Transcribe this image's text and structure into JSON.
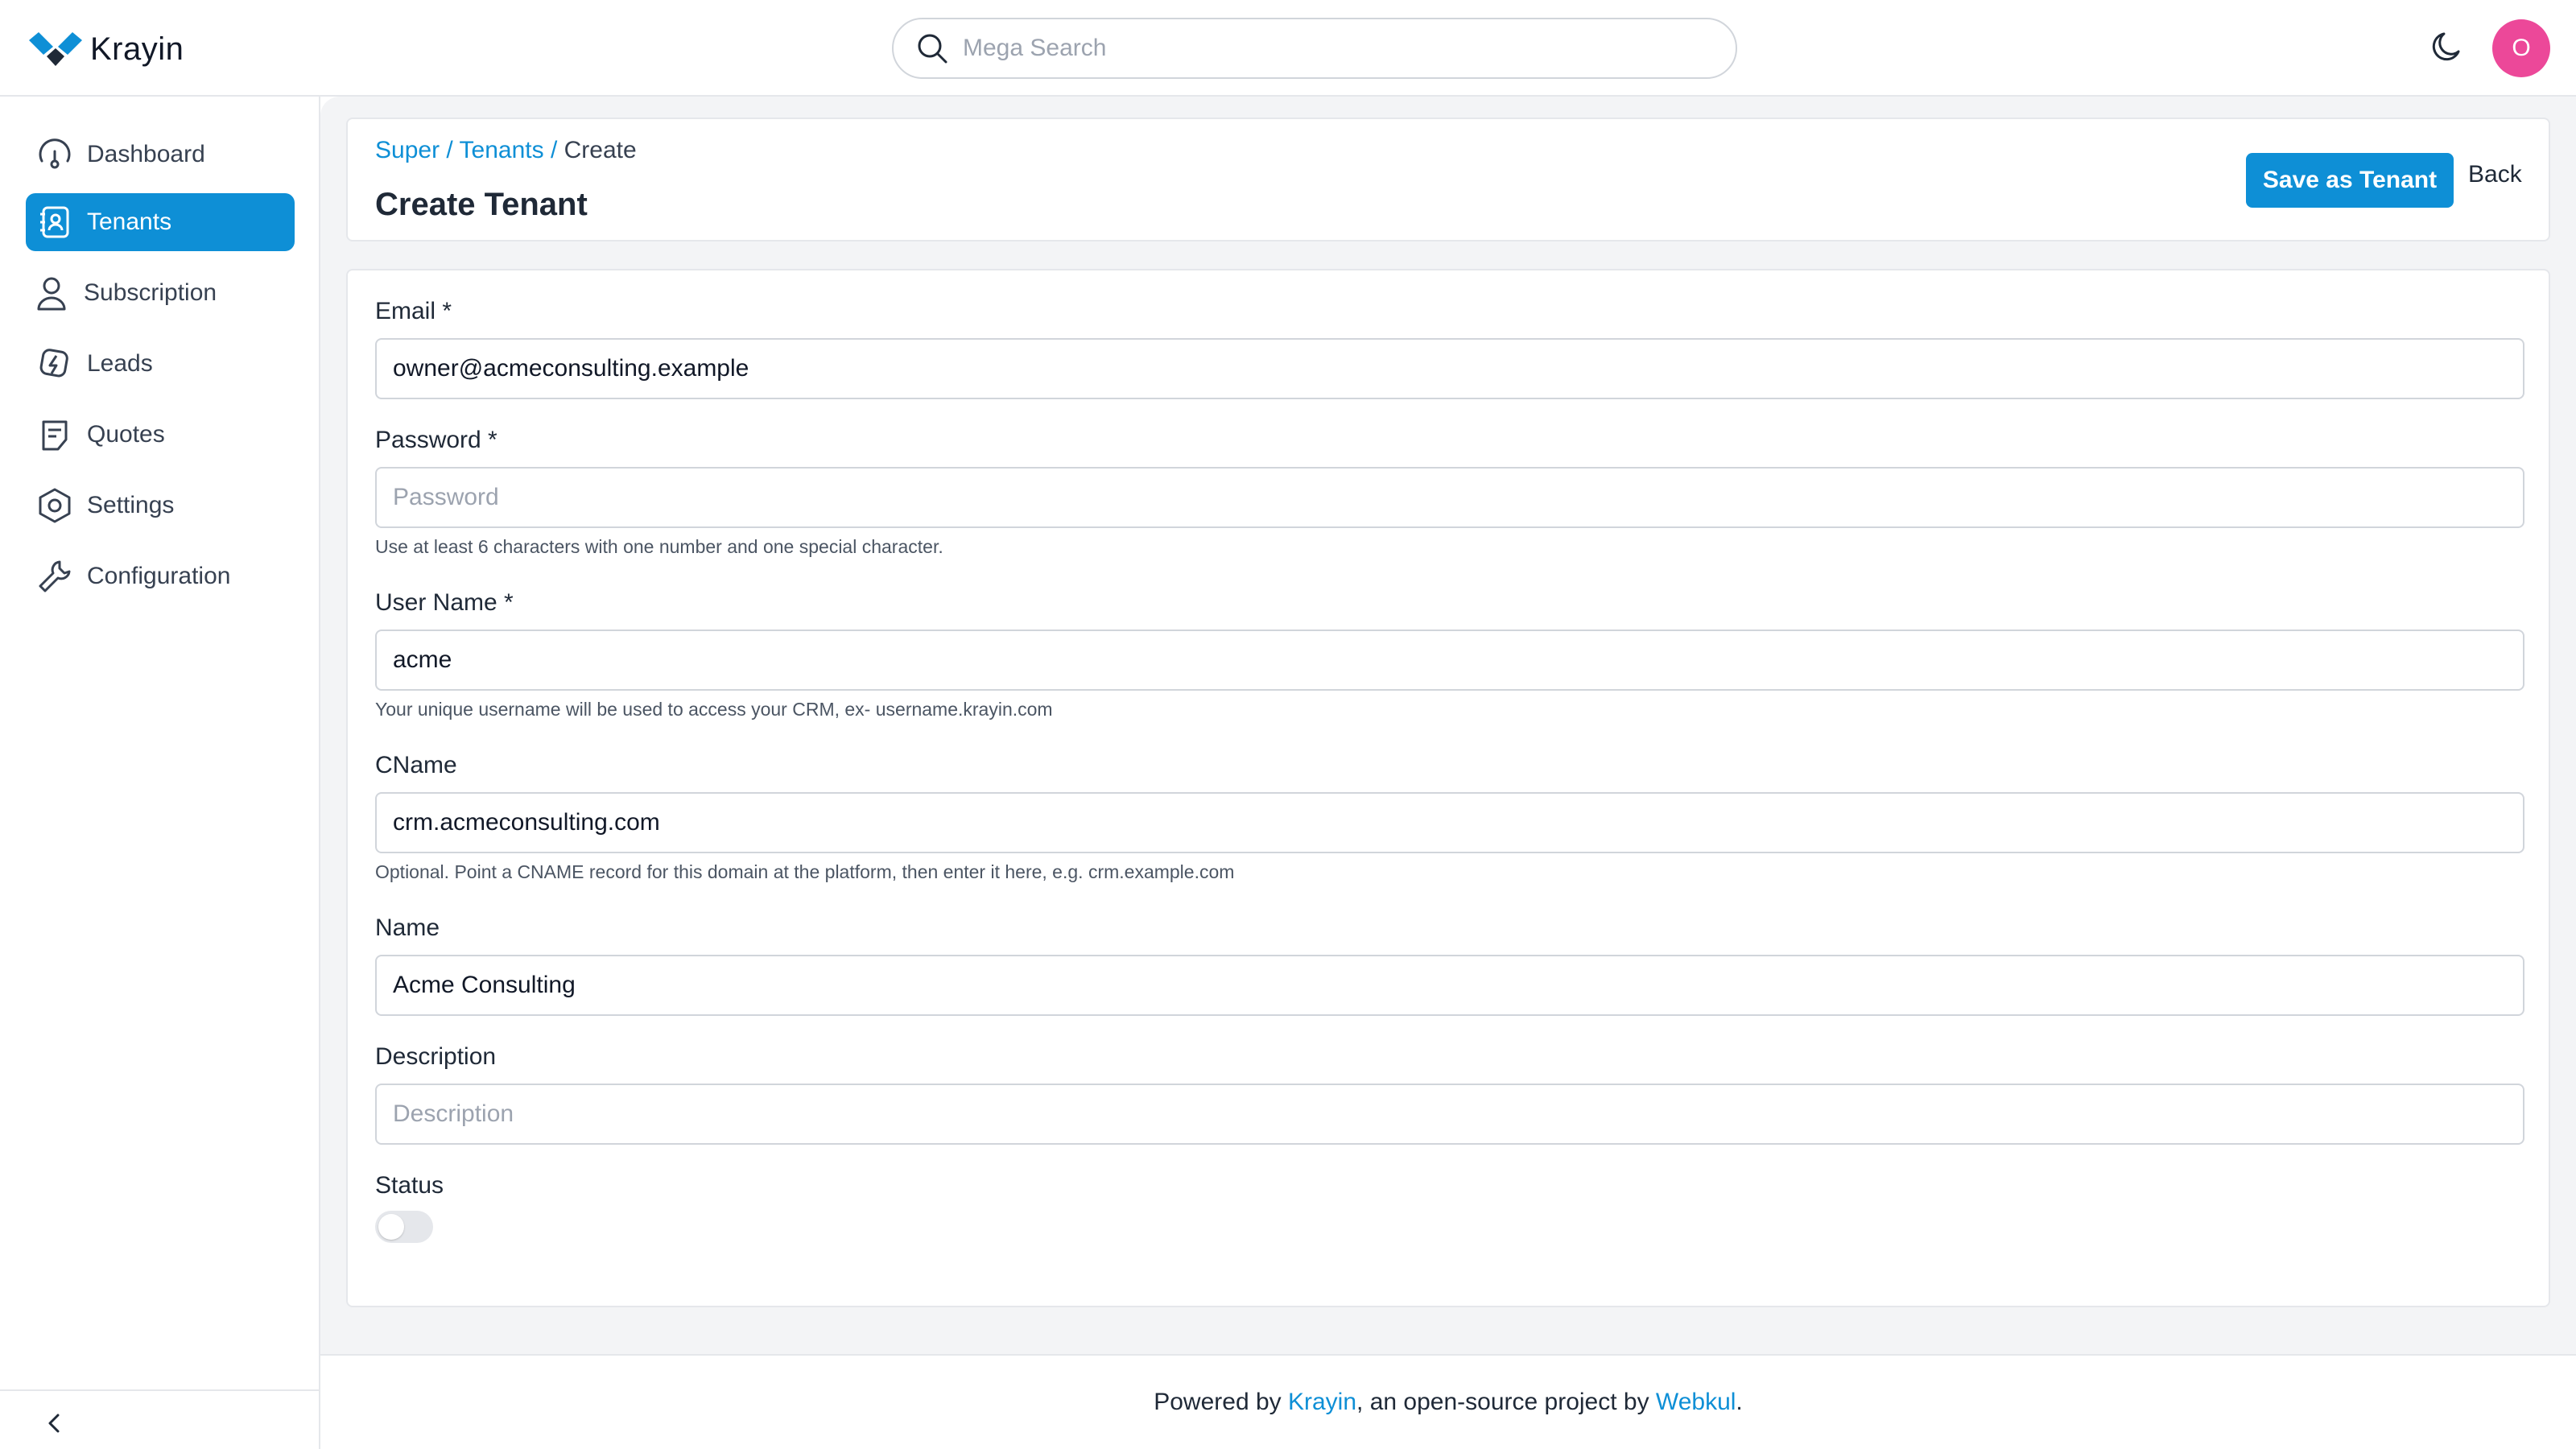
{
  "brand": {
    "name": "Krayin"
  },
  "search": {
    "placeholder": "Mega Search"
  },
  "user": {
    "avatar_initial": "O"
  },
  "sidebar": {
    "items": [
      {
        "label": "Dashboard",
        "icon": "dashboard-icon",
        "active": false
      },
      {
        "label": "Tenants",
        "icon": "tenants-icon",
        "active": true
      },
      {
        "label": "Subscription",
        "icon": "user-icon",
        "active": false
      },
      {
        "label": "Leads",
        "icon": "leads-icon",
        "active": false
      },
      {
        "label": "Quotes",
        "icon": "quotes-icon",
        "active": false
      },
      {
        "label": "Settings",
        "icon": "settings-icon",
        "active": false
      },
      {
        "label": "Configuration",
        "icon": "wrench-icon",
        "active": false
      }
    ]
  },
  "breadcrumb": {
    "super": "Super",
    "sep1": " / ",
    "tenants": "Tenants",
    "sep2": " / ",
    "current": "Create"
  },
  "page": {
    "title": "Create Tenant",
    "save_label": "Save as Tenant",
    "back_label": "Back"
  },
  "form": {
    "email": {
      "label": "Email *",
      "value": "owner@acmeconsulting.example"
    },
    "password": {
      "label": "Password *",
      "placeholder": "Password",
      "help": "Use at least 6 characters with one number and one special character."
    },
    "username": {
      "label": "User Name *",
      "value": "acme",
      "help": "Your unique username will be used to access your CRM, ex- username.krayin.com"
    },
    "cname": {
      "label": "CName",
      "value": "crm.acmeconsulting.com",
      "help": "Optional. Point a CNAME record for this domain at the platform, then enter it here, e.g. crm.example.com"
    },
    "name": {
      "label": "Name",
      "value": "Acme Consulting"
    },
    "description": {
      "label": "Description",
      "placeholder": "Description"
    },
    "status": {
      "label": "Status",
      "enabled": false
    }
  },
  "footer": {
    "prefix": "Powered by ",
    "krayin": "Krayin",
    "middle": ", an open-source project by ",
    "webkul": "Webkul",
    "suffix": "."
  },
  "colors": {
    "accent": "#0e8fd6",
    "avatar": "#ec4899",
    "background": "#f3f4f6"
  }
}
